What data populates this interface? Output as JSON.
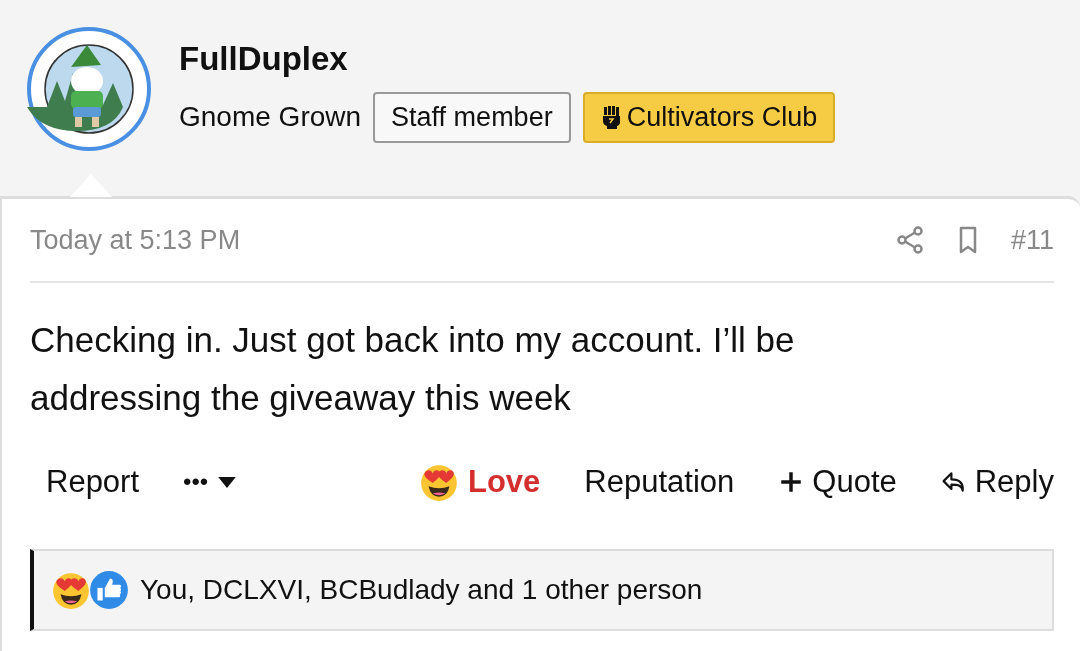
{
  "author": {
    "name": "FullDuplex",
    "title": "Gnome Grown",
    "banners": [
      {
        "label": "Staff member",
        "kind": "plain"
      },
      {
        "label": "Cultivators Club",
        "kind": "club"
      }
    ]
  },
  "post": {
    "date": "Today at 5:13 PM",
    "number": "#11",
    "body": "Checking in. Just got back into my account. I’ll be addressing the giveaway this week"
  },
  "actions": {
    "left": [
      {
        "label": "Report",
        "kind": "text"
      },
      {
        "label": "•••",
        "kind": "more"
      }
    ],
    "right": [
      {
        "label": "Love",
        "kind": "reaction",
        "selected": true
      },
      {
        "label": "Reputation",
        "kind": "text"
      },
      {
        "label": "Quote",
        "kind": "quote"
      },
      {
        "label": "Reply",
        "kind": "reply"
      }
    ]
  },
  "reactions_summary": {
    "text": "You, DCLXVI, BCBudlady and 1 other person"
  }
}
